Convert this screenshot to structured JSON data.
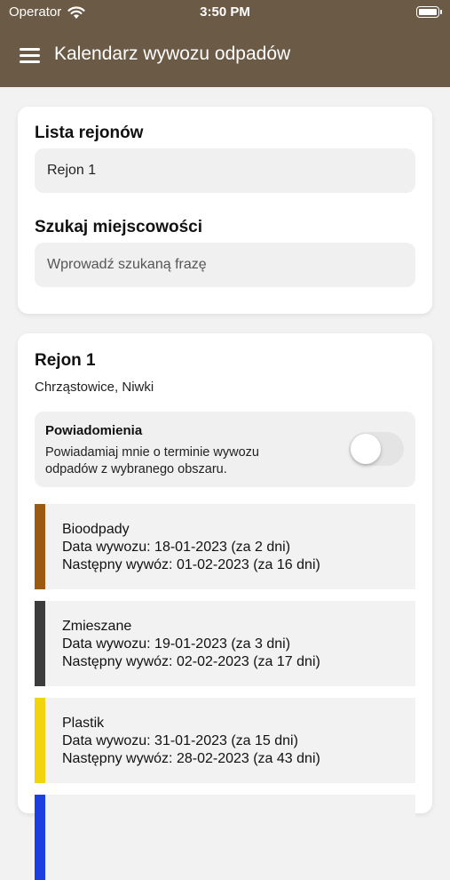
{
  "status_bar": {
    "carrier": "Operator",
    "time": "3:50 PM"
  },
  "nav": {
    "title": "Kalendarz wywozu odpadów",
    "menu_icon": "hamburger-menu-icon"
  },
  "colors": {
    "nav_bg": "#6b5a45"
  },
  "regions": {
    "label": "Lista rejonów",
    "selected": "Rejon 1"
  },
  "search": {
    "label": "Szukaj miejscowości",
    "placeholder": "Wprowadź szukaną frazę",
    "value": ""
  },
  "region_card": {
    "title": "Rejon 1",
    "places": "Chrząstowice, Niwki",
    "notifications": {
      "title": "Powiadomienia",
      "description": "Powiadamiaj mnie o terminie wywozu odpadów z wybranego obszaru.",
      "enabled": false
    },
    "waste": [
      {
        "name": "Bioodpady",
        "date": "Data wywozu: 18-01-2023 (za 2 dni)",
        "next": "Następny wywóz: 01-02-2023 (za 16 dni)",
        "color": "#9b5a10"
      },
      {
        "name": "Zmieszane",
        "date": "Data wywozu: 19-01-2023 (za 3 dni)",
        "next": "Następny wywóz: 02-02-2023 (za 17 dni)",
        "color": "#3c3c3c"
      },
      {
        "name": "Plastik",
        "date": "Data wywozu: 31-01-2023 (za 15 dni)",
        "next": "Następny wywóz: 28-02-2023 (za 43 dni)",
        "color": "#f2d30f"
      },
      {
        "name": "",
        "date": "",
        "next": "",
        "color": "#1d3fe0"
      }
    ]
  }
}
